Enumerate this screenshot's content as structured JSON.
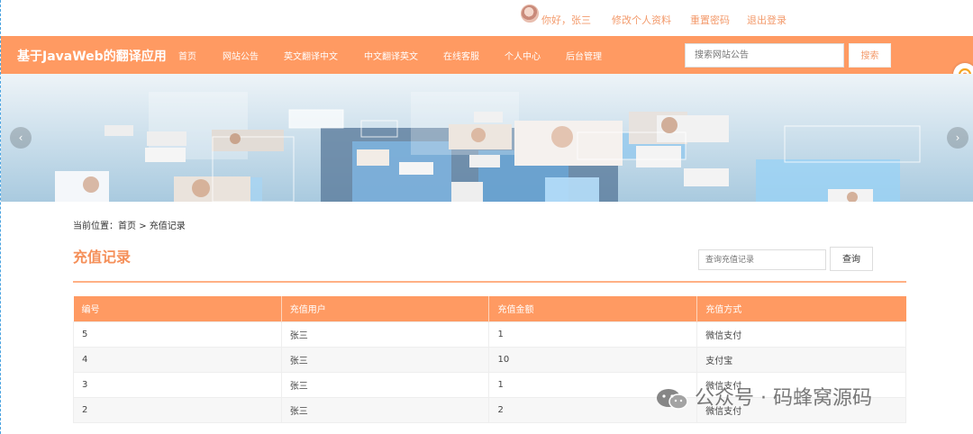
{
  "topbar": {
    "greeting": "你好，张三",
    "links": [
      "修改个人资料",
      "重置密码",
      "退出登录"
    ]
  },
  "nav": {
    "brand": "基于JavaWeb的翻译应用",
    "items": [
      "首页",
      "网站公告",
      "英文翻译中文",
      "中文翻译英文",
      "在线客服",
      "个人中心",
      "后台管理"
    ],
    "search_placeholder": "搜索网站公告",
    "search_button": "搜索"
  },
  "banner": {
    "prev_glyph": "‹",
    "next_glyph": "›"
  },
  "breadcrumb": {
    "prefix": "当前位置：",
    "home": "首页",
    "sep": ">",
    "current": "充值记录"
  },
  "page": {
    "title": "充值记录",
    "query_placeholder": "查询充值记录",
    "query_button": "查询"
  },
  "table": {
    "headers": [
      "编号",
      "充值用户",
      "充值金额",
      "充值方式"
    ],
    "rows": [
      [
        "5",
        "张三",
        "1",
        "微信支付"
      ],
      [
        "4",
        "张三",
        "10",
        "支付宝"
      ],
      [
        "3",
        "张三",
        "1",
        "微信支付"
      ],
      [
        "2",
        "张三",
        "2",
        "微信支付"
      ]
    ]
  },
  "watermark": "公众号 · 码蜂窝源码",
  "colors": {
    "accent": "#ff9a62",
    "accent_text": "#f39a6b",
    "title": "#f5905a"
  }
}
